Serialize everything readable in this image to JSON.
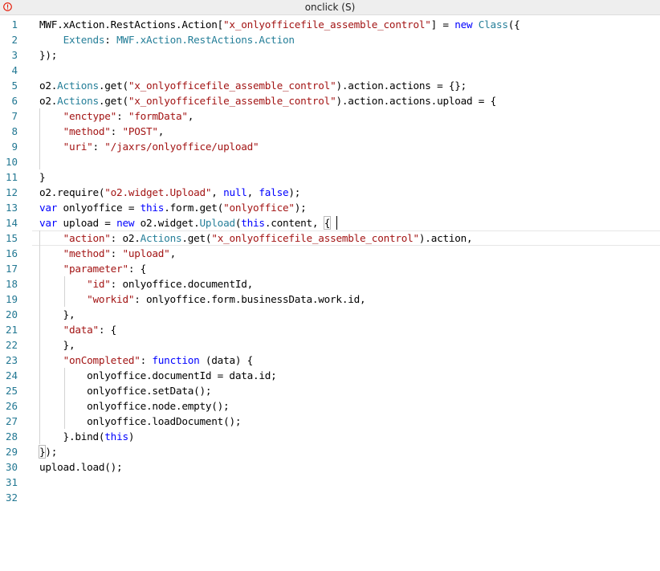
{
  "window": {
    "title": "onclick (S)",
    "icon": "error-icon",
    "accent_color": "#e51400"
  },
  "editor": {
    "line_numbers": [
      "1",
      "2",
      "3",
      "4",
      "5",
      "6",
      "7",
      "8",
      "9",
      "10",
      "11",
      "12",
      "13",
      "14",
      "15",
      "16",
      "17",
      "18",
      "19",
      "20",
      "21",
      "22",
      "23",
      "24",
      "25",
      "26",
      "27",
      "28",
      "29",
      "30",
      "31",
      "32"
    ],
    "current_line": 15,
    "lines": [
      [
        [
          "id",
          "MWF.xAction.RestActions.Action"
        ],
        [
          "pn",
          "["
        ],
        [
          "str",
          "\"x_onlyofficefile_assemble_control\""
        ],
        [
          "pn",
          "] = "
        ],
        [
          "kw",
          "new"
        ],
        [
          "pn",
          " "
        ],
        [
          "cls",
          "Class"
        ],
        [
          "pn",
          "({"
        ]
      ],
      [
        [
          "pn",
          "    "
        ],
        [
          "cls",
          "Extends"
        ],
        [
          "pn",
          ": "
        ],
        [
          "cls",
          "MWF.xAction.RestActions.Action"
        ]
      ],
      [
        [
          "pn",
          "});"
        ]
      ],
      [],
      [
        [
          "id",
          "o2."
        ],
        [
          "cls",
          "Actions"
        ],
        [
          "pn",
          "."
        ],
        [
          "id",
          "get"
        ],
        [
          "pn",
          "("
        ],
        [
          "str",
          "\"x_onlyofficefile_assemble_control\""
        ],
        [
          "pn",
          ").action.actions = {};"
        ]
      ],
      [
        [
          "id",
          "o2."
        ],
        [
          "cls",
          "Actions"
        ],
        [
          "pn",
          "."
        ],
        [
          "id",
          "get"
        ],
        [
          "pn",
          "("
        ],
        [
          "str",
          "\"x_onlyofficefile_assemble_control\""
        ],
        [
          "pn",
          ").action.actions.upload = {"
        ]
      ],
      [
        [
          "pn",
          "    "
        ],
        [
          "str",
          "\"enctype\""
        ],
        [
          "pn",
          ": "
        ],
        [
          "str",
          "\"formData\""
        ],
        [
          "pn",
          ","
        ]
      ],
      [
        [
          "pn",
          "    "
        ],
        [
          "str",
          "\"method\""
        ],
        [
          "pn",
          ": "
        ],
        [
          "str",
          "\"POST\""
        ],
        [
          "pn",
          ","
        ]
      ],
      [
        [
          "pn",
          "    "
        ],
        [
          "str",
          "\"uri\""
        ],
        [
          "pn",
          ": "
        ],
        [
          "str",
          "\"/jaxrs/onlyoffice/upload\""
        ]
      ],
      [],
      [
        [
          "pn",
          "}"
        ]
      ],
      [
        [
          "id",
          "o2.require"
        ],
        [
          "pn",
          "("
        ],
        [
          "str",
          "\"o2.widget.Upload\""
        ],
        [
          "pn",
          ", "
        ],
        [
          "kw",
          "null"
        ],
        [
          "pn",
          ", "
        ],
        [
          "kw",
          "false"
        ],
        [
          "pn",
          ");"
        ]
      ],
      [
        [
          "kw",
          "var"
        ],
        [
          "pn",
          " onlyoffice = "
        ],
        [
          "kw",
          "this"
        ],
        [
          "pn",
          "."
        ],
        [
          "id",
          "form.get"
        ],
        [
          "pn",
          "("
        ],
        [
          "str",
          "\"onlyoffice\""
        ],
        [
          "pn",
          ");"
        ]
      ],
      [
        [
          "kw",
          "var"
        ],
        [
          "pn",
          " upload = "
        ],
        [
          "kw",
          "new"
        ],
        [
          "pn",
          " o2.widget."
        ],
        [
          "cls",
          "Upload"
        ],
        [
          "pn",
          "("
        ],
        [
          "kw",
          "this"
        ],
        [
          "pn",
          ".content, "
        ],
        [
          "br",
          "{"
        ]
      ],
      [
        [
          "pn",
          "    "
        ],
        [
          "str",
          "\"action\""
        ],
        [
          "pn",
          ": o2."
        ],
        [
          "cls",
          "Actions"
        ],
        [
          "pn",
          "."
        ],
        [
          "id",
          "get"
        ],
        [
          "pn",
          "("
        ],
        [
          "str",
          "\"x_onlyofficefile_assemble_control\""
        ],
        [
          "pn",
          ").action,"
        ]
      ],
      [
        [
          "pn",
          "    "
        ],
        [
          "str",
          "\"method\""
        ],
        [
          "pn",
          ": "
        ],
        [
          "str",
          "\"upload\""
        ],
        [
          "pn",
          ","
        ]
      ],
      [
        [
          "pn",
          "    "
        ],
        [
          "str",
          "\"parameter\""
        ],
        [
          "pn",
          ": {"
        ]
      ],
      [
        [
          "pn",
          "        "
        ],
        [
          "str",
          "\"id\""
        ],
        [
          "pn",
          ": onlyoffice.documentId,"
        ]
      ],
      [
        [
          "pn",
          "        "
        ],
        [
          "str",
          "\"workid\""
        ],
        [
          "pn",
          ": onlyoffice.form.businessData.work.id,"
        ]
      ],
      [
        [
          "pn",
          "    },"
        ]
      ],
      [
        [
          "pn",
          "    "
        ],
        [
          "str",
          "\"data\""
        ],
        [
          "pn",
          ": {"
        ]
      ],
      [
        [
          "pn",
          "    },"
        ]
      ],
      [
        [
          "pn",
          "    "
        ],
        [
          "str",
          "\"onCompleted\""
        ],
        [
          "pn",
          ": "
        ],
        [
          "kw",
          "function"
        ],
        [
          "pn",
          " (data) {"
        ]
      ],
      [
        [
          "pn",
          "        onlyoffice.documentId = data.id;"
        ]
      ],
      [
        [
          "pn",
          "        onlyoffice."
        ],
        [
          "id",
          "setData"
        ],
        [
          "pn",
          "();"
        ]
      ],
      [
        [
          "pn",
          "        onlyoffice.node."
        ],
        [
          "id",
          "empty"
        ],
        [
          "pn",
          "();"
        ]
      ],
      [
        [
          "pn",
          "        onlyoffice."
        ],
        [
          "id",
          "loadDocument"
        ],
        [
          "pn",
          "();"
        ]
      ],
      [
        [
          "pn",
          "    }."
        ],
        [
          "id",
          "bind"
        ],
        [
          "pn",
          "("
        ],
        [
          "kw",
          "this"
        ],
        [
          "pn",
          ")"
        ]
      ],
      [
        [
          "br",
          "}"
        ],
        [
          "pn",
          ");"
        ]
      ],
      [
        [
          "id",
          "upload.load"
        ],
        [
          "pn",
          "();"
        ]
      ],
      [],
      []
    ]
  }
}
